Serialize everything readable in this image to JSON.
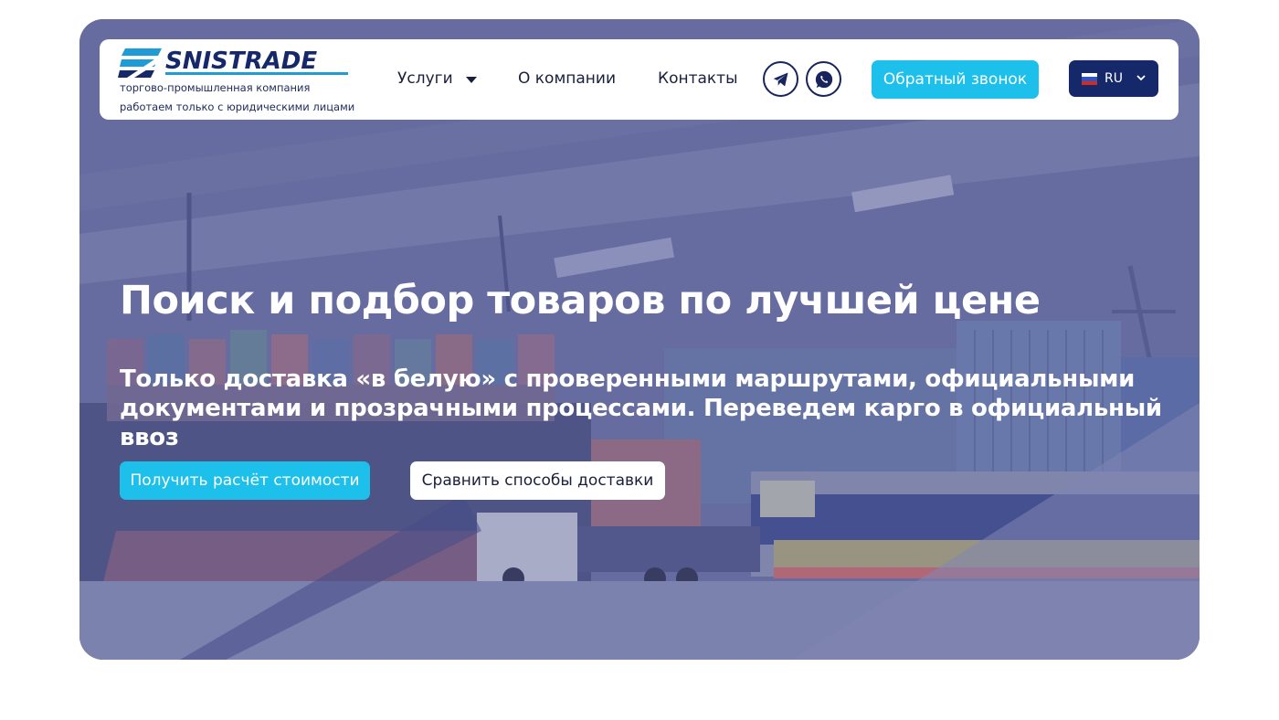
{
  "brand": {
    "logo_text": "SNISTRADE",
    "tagline_1": "торгово-промышленная компания",
    "tagline_2": "работаем только с юридическими лицами"
  },
  "nav": {
    "services": "Услуги",
    "about": "О компании",
    "contacts": "Контакты"
  },
  "social": {
    "telegram_icon": "telegram-icon",
    "whatsapp_icon": "whatsapp-icon"
  },
  "header": {
    "callback_label": "Обратный звонок",
    "language": "RU"
  },
  "hero": {
    "title": "Поиск и подбор товаров по лучшей цене",
    "subtitle": "Только доставка «в белую» с проверенными маршрутами, официальными документами и прозрачными процессами. Переведем карго в официальный ввоз",
    "primary_button": "Получить расчёт стоимости",
    "secondary_button": "Сравнить способы доставки"
  },
  "colors": {
    "accent": "#1cc0ea",
    "brand_dark": "#14286a",
    "overlay": "#6a6fa0"
  }
}
